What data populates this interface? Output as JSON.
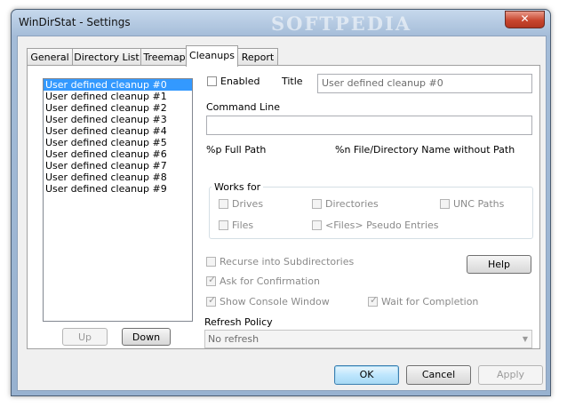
{
  "window": {
    "title": "WinDirStat - Settings",
    "watermark": "SOFTPEDIA",
    "close_glyph": "✕"
  },
  "tabs": [
    {
      "label": "General",
      "active": false
    },
    {
      "label": "Directory List",
      "active": false
    },
    {
      "label": "Treemap",
      "active": false
    },
    {
      "label": "Cleanups",
      "active": true
    },
    {
      "label": "Report",
      "active": false
    }
  ],
  "cleanups": {
    "list_items": [
      "User defined cleanup #0",
      "User defined cleanup #1",
      "User defined cleanup #2",
      "User defined cleanup #3",
      "User defined cleanup #4",
      "User defined cleanup #5",
      "User defined cleanup #6",
      "User defined cleanup #7",
      "User defined cleanup #8",
      "User defined cleanup #9"
    ],
    "selected_index": 0,
    "up_label": "Up",
    "down_label": "Down",
    "enabled_label": "Enabled",
    "title_label": "Title",
    "title_value": "User defined cleanup #0",
    "command_line_label": "Command Line",
    "command_line_value": "",
    "hint_path": "%p Full Path",
    "hint_name": "%n File/Directory Name without Path",
    "works_for_label": "Works for",
    "drives_label": "Drives",
    "directories_label": "Directories",
    "unc_paths_label": "UNC Paths",
    "files_label": "Files",
    "pseudo_entries_label": "<Files> Pseudo Entries",
    "recurse_label": "Recurse into Subdirectories",
    "help_label": "Help",
    "ask_confirmation_label": "Ask for Confirmation",
    "show_console_label": "Show Console Window",
    "wait_completion_label": "Wait for Completion",
    "refresh_policy_label": "Refresh Policy",
    "refresh_policy_value": "No refresh"
  },
  "footer": {
    "ok_label": "OK",
    "cancel_label": "Cancel",
    "apply_label": "Apply"
  }
}
